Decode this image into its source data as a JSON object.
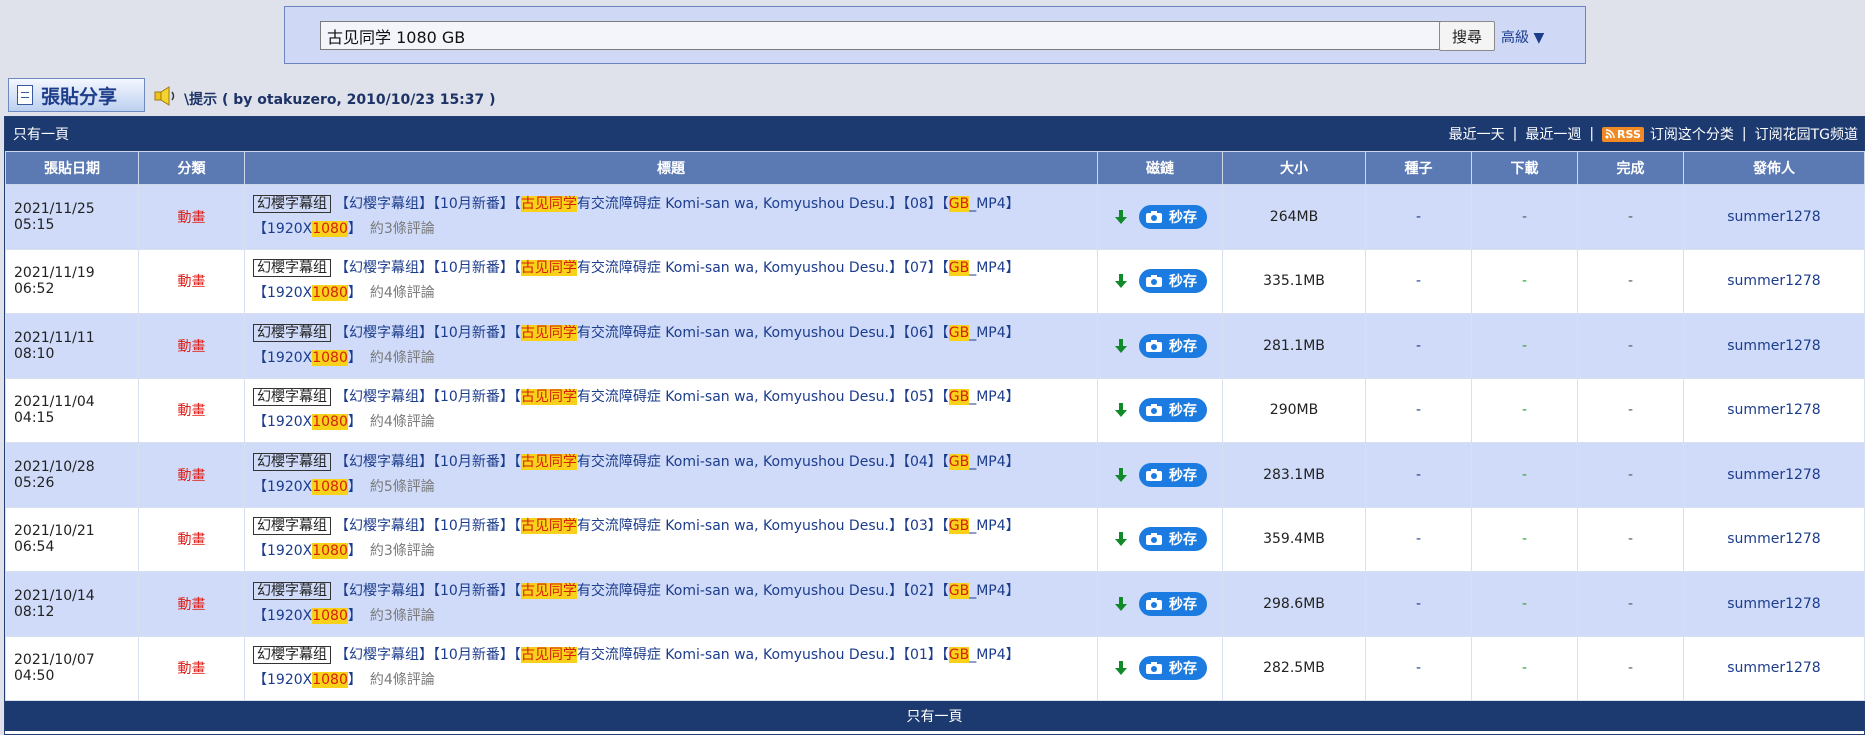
{
  "search": {
    "query": "古见同学 1080 GB",
    "button": "搜尋",
    "advanced": "高級 ▼"
  },
  "announce": {
    "post_button": "張貼分享",
    "hint": "\\提示 ( by otakuzero, 2010/10/23 15:37 )"
  },
  "table_header_bar": {
    "pages": "只有一頁",
    "links": [
      "最近一天",
      "最近一週",
      "订阅这个分类",
      "订阅花园TG频道"
    ],
    "rss": "RSS"
  },
  "columns": [
    "張貼日期",
    "分類",
    "標題",
    "磁鏈",
    "大小",
    "種子",
    "下載",
    "完成",
    "發佈人"
  ],
  "rows": [
    {
      "date": "2021/11/25 05:15",
      "category": "動畫",
      "team": "幻櫻字幕组",
      "pre": "【幻樱字幕组】【10月新番】【",
      "hl1": "古见同学",
      "mid": "有交流障碍症 Komi-san wa, Komyushou Desu.】【08】【",
      "hl2": "GB",
      "post": "_MP4】",
      "res_pre": "【1920X",
      "hl3": "1080",
      "res_post": "】",
      "comments": "約3條評論",
      "save": "秒存",
      "size": "264MB",
      "seeds": "-",
      "downloads": "-",
      "complete": "-",
      "publisher": "summer1278",
      "dl_color": "dark"
    },
    {
      "date": "2021/11/19 06:52",
      "category": "動畫",
      "team": "幻櫻字幕组",
      "pre": "【幻樱字幕组】【10月新番】【",
      "hl1": "古见同学",
      "mid": "有交流障碍症 Komi-san wa, Komyushou Desu.】【07】【",
      "hl2": "GB",
      "post": "_MP4】",
      "res_pre": "【1920X",
      "hl3": "1080",
      "res_post": "】",
      "comments": "約4條評論",
      "save": "秒存",
      "size": "335.1MB",
      "seeds": "-",
      "downloads": "-",
      "complete": "-",
      "publisher": "summer1278",
      "dl_color": "green"
    },
    {
      "date": "2021/11/11 08:10",
      "category": "動畫",
      "team": "幻櫻字幕组",
      "pre": "【幻樱字幕组】【10月新番】【",
      "hl1": "古见同学",
      "mid": "有交流障碍症 Komi-san wa, Komyushou Desu.】【06】【",
      "hl2": "GB",
      "post": "_MP4】",
      "res_pre": "【1920X",
      "hl3": "1080",
      "res_post": "】",
      "comments": "約4條評論",
      "save": "秒存",
      "size": "281.1MB",
      "seeds": "-",
      "downloads": "-",
      "complete": "-",
      "publisher": "summer1278",
      "dl_color": "green"
    },
    {
      "date": "2021/11/04 04:15",
      "category": "動畫",
      "team": "幻櫻字幕组",
      "pre": "【幻樱字幕组】【10月新番】【",
      "hl1": "古见同学",
      "mid": "有交流障碍症 Komi-san wa, Komyushou Desu.】【05】【",
      "hl2": "GB",
      "post": "_MP4】",
      "res_pre": "【1920X",
      "hl3": "1080",
      "res_post": "】",
      "comments": "約4條評論",
      "save": "秒存",
      "size": "290MB",
      "seeds": "-",
      "downloads": "-",
      "complete": "-",
      "publisher": "summer1278",
      "dl_color": "green"
    },
    {
      "date": "2021/10/28 05:26",
      "category": "動畫",
      "team": "幻櫻字幕组",
      "pre": "【幻樱字幕组】【10月新番】【",
      "hl1": "古见同学",
      "mid": "有交流障碍症 Komi-san wa, Komyushou Desu.】【04】【",
      "hl2": "GB",
      "post": "_MP4】",
      "res_pre": "【1920X",
      "hl3": "1080",
      "res_post": "】",
      "comments": "約5條評論",
      "save": "秒存",
      "size": "283.1MB",
      "seeds": "-",
      "downloads": "-",
      "complete": "-",
      "publisher": "summer1278",
      "dl_color": "green"
    },
    {
      "date": "2021/10/21 06:54",
      "category": "動畫",
      "team": "幻櫻字幕组",
      "pre": "【幻樱字幕组】【10月新番】【",
      "hl1": "古见同学",
      "mid": "有交流障碍症 Komi-san wa, Komyushou Desu.】【03】【",
      "hl2": "GB",
      "post": "_MP4】",
      "res_pre": "【1920X",
      "hl3": "1080",
      "res_post": "】",
      "comments": "約3條評論",
      "save": "秒存",
      "size": "359.4MB",
      "seeds": "-",
      "downloads": "-",
      "complete": "-",
      "publisher": "summer1278",
      "dl_color": "green"
    },
    {
      "date": "2021/10/14 08:12",
      "category": "動畫",
      "team": "幻櫻字幕组",
      "pre": "【幻樱字幕组】【10月新番】【",
      "hl1": "古见同学",
      "mid": "有交流障碍症 Komi-san wa, Komyushou Desu.】【02】【",
      "hl2": "GB",
      "post": "_MP4】",
      "res_pre": "【1920X",
      "hl3": "1080",
      "res_post": "】",
      "comments": "約3條評論",
      "save": "秒存",
      "size": "298.6MB",
      "seeds": "-",
      "downloads": "-",
      "complete": "-",
      "publisher": "summer1278",
      "dl_color": "green"
    },
    {
      "date": "2021/10/07 04:50",
      "category": "動畫",
      "team": "幻櫻字幕组",
      "pre": "【幻樱字幕组】【10月新番】【",
      "hl1": "古见同学",
      "mid": "有交流障碍症 Komi-san wa, Komyushou Desu.】【01】【",
      "hl2": "GB",
      "post": "_MP4】",
      "res_pre": "【1920X",
      "hl3": "1080",
      "res_post": "】",
      "comments": "約4條評論",
      "save": "秒存",
      "size": "282.5MB",
      "seeds": "-",
      "downloads": "-",
      "complete": "-",
      "publisher": "summer1278",
      "dl_color": "green"
    }
  ],
  "footer": {
    "pages": "只有一頁"
  },
  "colors": {
    "header_bar": "#1c3a70",
    "column_header": "#5b79b3",
    "odd_row": "#cfdbf9",
    "highlight": "#f8d21a",
    "category": "#e0201a",
    "save_button": "#1b7be0"
  }
}
